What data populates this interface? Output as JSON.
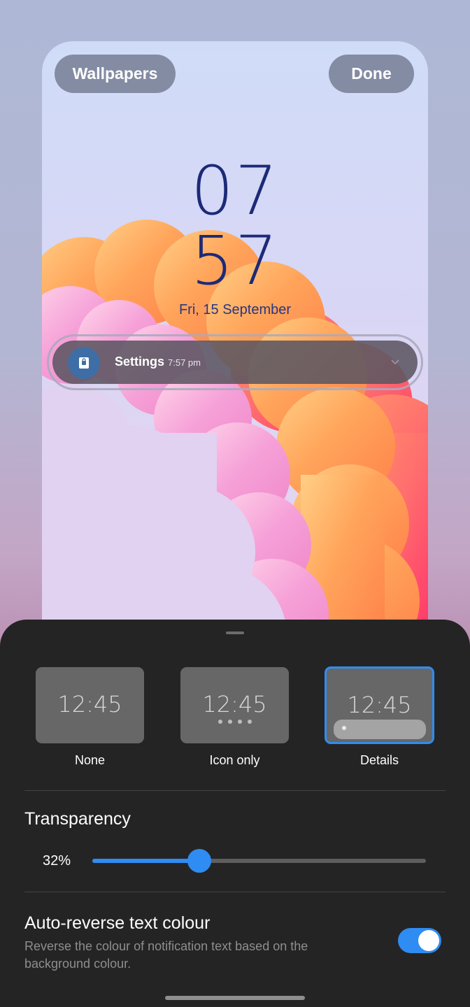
{
  "preview": {
    "wallpapers_label": "Wallpapers",
    "done_label": "Done",
    "clock_hours": "07",
    "clock_minutes": "57",
    "date": "Fri, 15 September",
    "notification": {
      "app": "Settings",
      "time": "7:57 pm",
      "icon": "settings-app-icon"
    }
  },
  "style_options": [
    {
      "label": "None",
      "time": "12:45",
      "selected": false
    },
    {
      "label": "Icon only",
      "time": "12:45",
      "selected": false
    },
    {
      "label": "Details",
      "time": "12:45",
      "selected": true
    }
  ],
  "transparency": {
    "title": "Transparency",
    "value_label": "32%",
    "value": 0.32
  },
  "auto_reverse": {
    "title": "Auto-reverse text colour",
    "description": "Reverse the colour of notification text based on the background colour.",
    "enabled": true
  },
  "colors": {
    "accent": "#2f8cf2",
    "sheet": "#242424",
    "clock": "#1c2a78"
  }
}
